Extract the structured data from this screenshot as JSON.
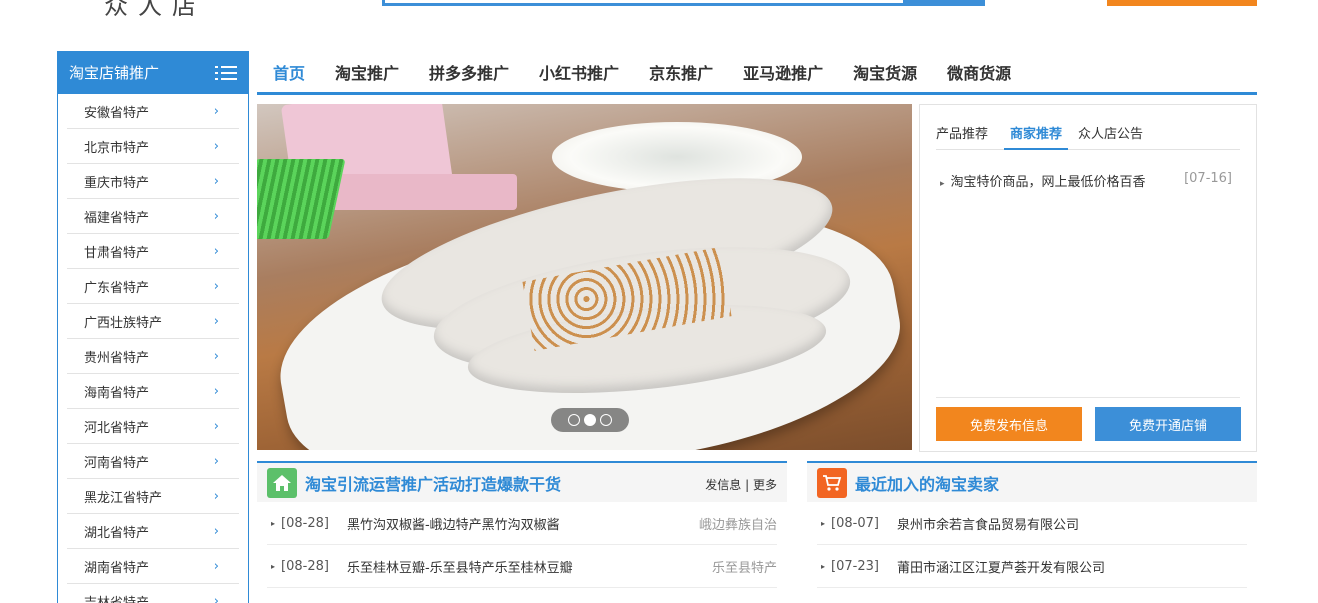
{
  "header": {
    "logo_text": "众人店"
  },
  "sidebar": {
    "title": "淘宝店铺推广",
    "items": [
      {
        "label": "安徽省特产"
      },
      {
        "label": "北京市特产"
      },
      {
        "label": "重庆市特产"
      },
      {
        "label": "福建省特产"
      },
      {
        "label": "甘肃省特产"
      },
      {
        "label": "广东省特产"
      },
      {
        "label": "广西壮族特产"
      },
      {
        "label": "贵州省特产"
      },
      {
        "label": "海南省特产"
      },
      {
        "label": "河北省特产"
      },
      {
        "label": "河南省特产"
      },
      {
        "label": "黑龙江省特产"
      },
      {
        "label": "湖北省特产"
      },
      {
        "label": "湖南省特产"
      },
      {
        "label": "吉林省特产"
      }
    ]
  },
  "nav": {
    "items": [
      {
        "label": "首页"
      },
      {
        "label": "淘宝推广"
      },
      {
        "label": "拼多多推广"
      },
      {
        "label": "小红书推广"
      },
      {
        "label": "京东推广"
      },
      {
        "label": "亚马逊推广"
      },
      {
        "label": "淘宝货源"
      },
      {
        "label": "微商货源"
      }
    ]
  },
  "slider": {
    "active_dot": 2,
    "dot_count": 3
  },
  "notice": {
    "tabs": [
      {
        "label": "产品推荐"
      },
      {
        "label": "商家推荐"
      },
      {
        "label": "众人店公告"
      }
    ],
    "items": [
      {
        "title": "淘宝特价商品，网上最低价格百香",
        "date": "[07-16]"
      }
    ],
    "publish_button": "免费发布信息",
    "open_shop_button": "免费开通店铺"
  },
  "left_panel": {
    "title": "淘宝引流运营推广活动打造爆款干货",
    "link_post": "发信息",
    "link_sep": " | ",
    "link_more": "更多",
    "rows": [
      {
        "date": "[08-28]",
        "title": "黑竹沟双椒酱-峨边特产黑竹沟双椒酱",
        "tag": "峨边彝族自治"
      },
      {
        "date": "[08-28]",
        "title": "乐至桂林豆瓣-乐至县特产乐至桂林豆瓣",
        "tag": "乐至县特产"
      }
    ]
  },
  "right_panel": {
    "title": "最近加入的淘宝卖家",
    "rows": [
      {
        "date": "[08-07]",
        "title": "泉州市余若言食品贸易有限公司"
      },
      {
        "date": "[07-23]",
        "title": "莆田市涵江区江夏芦荟开发有限公司"
      }
    ]
  },
  "colors": {
    "primary": "#2f8ad6",
    "orange": "#f2861e",
    "green_icon": "#5cc06a",
    "orange_icon": "#f26522"
  }
}
